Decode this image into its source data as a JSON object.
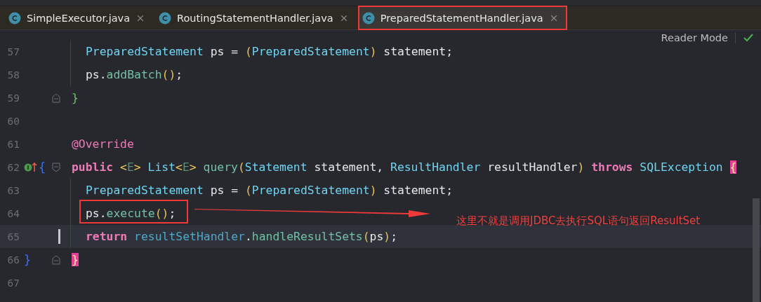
{
  "tabs": [
    {
      "label": "SimpleExecutor.java",
      "selected": false
    },
    {
      "label": "RoutingStatementHandler.java",
      "selected": false
    },
    {
      "label": "PreparedStatementHandler.java",
      "selected": true
    }
  ],
  "reader_mode": {
    "label": "Reader Mode"
  },
  "editor": {
    "lines": [
      {
        "number": "57",
        "indented": true,
        "current": false,
        "fold_start": false,
        "fold_end": false,
        "implements": false,
        "tokens": [
          {
            "text": "PreparedStatement",
            "kind": "type"
          },
          {
            "text": " ps = ",
            "kind": "plain"
          },
          {
            "text": "(",
            "kind": "paren"
          },
          {
            "text": "PreparedStatement",
            "kind": "type"
          },
          {
            "text": ")",
            "kind": "paren"
          },
          {
            "text": " statement;",
            "kind": "plain"
          }
        ]
      },
      {
        "number": "58",
        "indented": true,
        "current": false,
        "fold_start": false,
        "fold_end": false,
        "implements": false,
        "tokens": [
          {
            "text": "ps.",
            "kind": "plain"
          },
          {
            "text": "addBatch",
            "kind": "method"
          },
          {
            "text": "()",
            "kind": "paren"
          },
          {
            "text": ";",
            "kind": "plain"
          }
        ]
      },
      {
        "number": "59",
        "indented": false,
        "current": false,
        "fold_start": false,
        "fold_end": true,
        "implements": false,
        "tokens": [
          {
            "text": "}",
            "kind": "brace"
          }
        ]
      },
      {
        "number": "60",
        "indented": false,
        "current": false,
        "fold_start": false,
        "fold_end": false,
        "implements": false
      },
      {
        "number": "61",
        "indented": false,
        "current": false,
        "fold_start": false,
        "fold_end": false,
        "implements": false,
        "tokens": [
          {
            "text": "@Override",
            "kind": "annotation"
          }
        ]
      },
      {
        "number": "62",
        "indented": false,
        "current": false,
        "fold_start": true,
        "fold_end": false,
        "implements": true,
        "gutter_text": "{",
        "tokens": [
          {
            "text": "public ",
            "kind": "keyword"
          },
          {
            "text": "<",
            "kind": "paren"
          },
          {
            "text": "E",
            "kind": "generic"
          },
          {
            "text": "> ",
            "kind": "paren"
          },
          {
            "text": "List",
            "kind": "type"
          },
          {
            "text": "<",
            "kind": "paren"
          },
          {
            "text": "E",
            "kind": "generic"
          },
          {
            "text": "> ",
            "kind": "paren"
          },
          {
            "text": "query",
            "kind": "method"
          },
          {
            "text": "(",
            "kind": "paren"
          },
          {
            "text": "Statement",
            "kind": "type"
          },
          {
            "text": " statement, ",
            "kind": "plain"
          },
          {
            "text": "ResultHandler",
            "kind": "type"
          },
          {
            "text": " resultHandler",
            "kind": "plain"
          },
          {
            "text": ") ",
            "kind": "paren"
          },
          {
            "text": "throws ",
            "kind": "keyword"
          },
          {
            "text": "SQLException ",
            "kind": "type"
          },
          {
            "text": "{",
            "kind": "brace_match"
          }
        ]
      },
      {
        "number": "63",
        "indented": true,
        "current": false,
        "fold_start": false,
        "fold_end": false,
        "implements": false,
        "tokens": [
          {
            "text": "PreparedStatement",
            "kind": "type"
          },
          {
            "text": " ps = ",
            "kind": "plain"
          },
          {
            "text": "(",
            "kind": "paren"
          },
          {
            "text": "PreparedStatement",
            "kind": "type"
          },
          {
            "text": ")",
            "kind": "paren"
          },
          {
            "text": " statement;",
            "kind": "plain"
          }
        ]
      },
      {
        "number": "64",
        "indented": true,
        "current": false,
        "fold_start": false,
        "fold_end": false,
        "implements": false,
        "tokens": [
          {
            "text": "ps.",
            "kind": "plain"
          },
          {
            "text": "execute",
            "kind": "method"
          },
          {
            "text": "()",
            "kind": "paren"
          },
          {
            "text": ";",
            "kind": "plain"
          }
        ]
      },
      {
        "number": "65",
        "indented": true,
        "current": true,
        "fold_start": false,
        "fold_end": false,
        "implements": false,
        "tokens": [
          {
            "text": "return ",
            "kind": "keyword"
          },
          {
            "text": "resultSetHandler",
            "kind": "field"
          },
          {
            "text": ".",
            "kind": "plain"
          },
          {
            "text": "handleResultSets",
            "kind": "method"
          },
          {
            "text": "(",
            "kind": "paren"
          },
          {
            "text": "ps",
            "kind": "plain"
          },
          {
            "text": ")",
            "kind": "paren"
          },
          {
            "text": ";",
            "kind": "plain"
          }
        ]
      },
      {
        "number": "66",
        "indented": false,
        "current": false,
        "fold_start": false,
        "fold_end": true,
        "implements": false,
        "gutter_text": "}",
        "tokens": [
          {
            "text": "}",
            "kind": "brace_match"
          }
        ]
      },
      {
        "number": "67",
        "indented": false,
        "current": false,
        "fold_start": false,
        "fold_end": false,
        "implements": false
      }
    ]
  },
  "annotation": {
    "text": "这里不就是调用JDBC去执行SQL语句返回ResultSet"
  }
}
